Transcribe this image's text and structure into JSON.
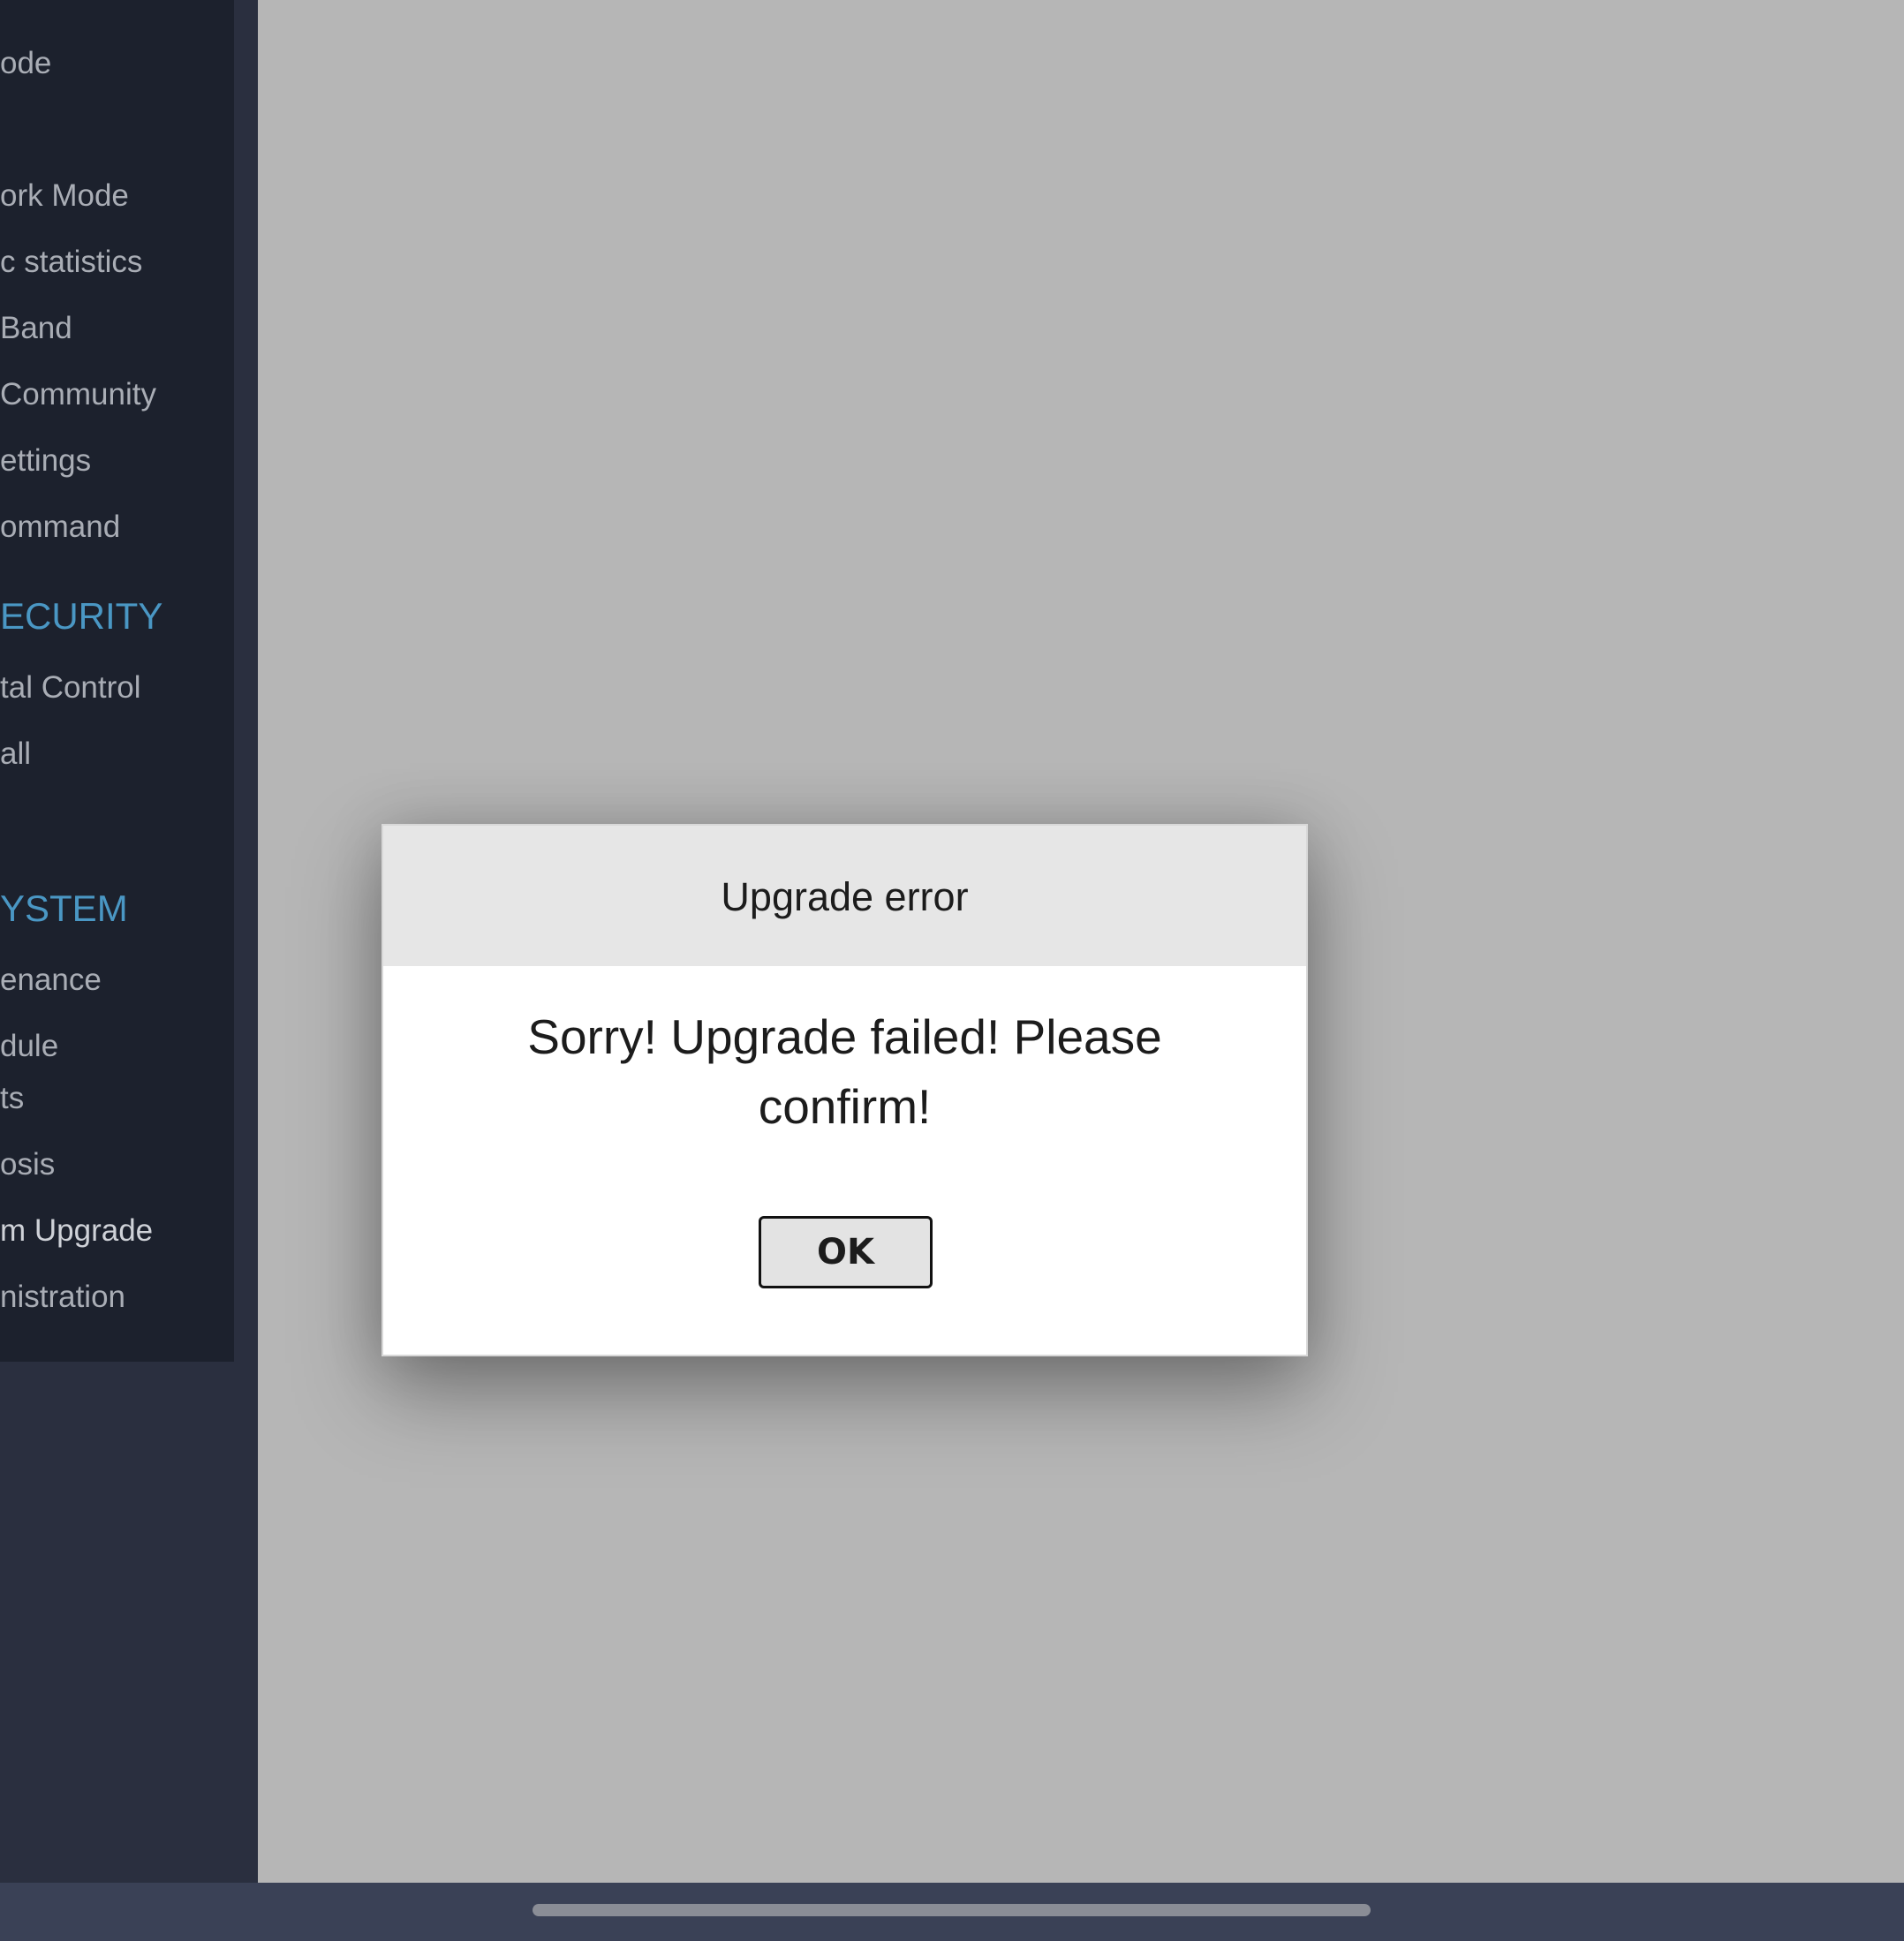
{
  "sidebar": {
    "items": [
      {
        "label": "ode"
      },
      {
        "label": "ork Mode"
      },
      {
        "label": "c statistics"
      },
      {
        "label": "Band"
      },
      {
        "label": "Community"
      },
      {
        "label": "ettings"
      },
      {
        "label": "ommand"
      },
      {
        "section": "ECURITY"
      },
      {
        "label": "tal Control"
      },
      {
        "label": "all"
      },
      {
        "section": "YSTEM"
      },
      {
        "label": "enance"
      },
      {
        "label": "dule"
      },
      {
        "label": "ts"
      },
      {
        "label": "osis"
      },
      {
        "label": "m Upgrade"
      },
      {
        "label": "nistration"
      }
    ]
  },
  "dialog": {
    "title": "Upgrade error",
    "message_line1": "Sorry! Upgrade failed! Please",
    "message_line2": "confirm!",
    "ok_label": "OK"
  },
  "colors": {
    "overlay": "#b6b6b6",
    "sidebar": "#1c212d",
    "section_heading": "#4a97c4",
    "dialog_header": "#e6e6e6"
  }
}
